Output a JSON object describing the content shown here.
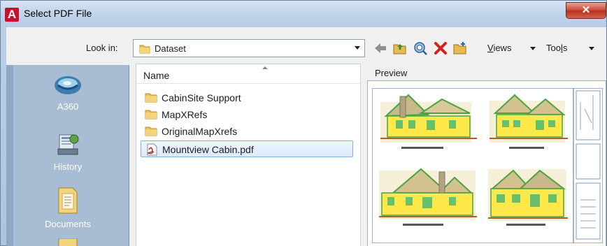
{
  "window": {
    "title": "Select PDF File",
    "app_icon": "A",
    "close_glyph": "✕"
  },
  "toolbar": {
    "look_in_label": "Look in:",
    "look_in_value": "Dataset",
    "views_label_first": "V",
    "views_label_rest": "iews",
    "tools_label_first": "Too",
    "tools_label_u": "l",
    "tools_label_rest": "s",
    "icons": [
      "back-arrow-icon",
      "up-folder-icon",
      "search-web-icon",
      "delete-icon",
      "new-folder-icon"
    ]
  },
  "places": [
    {
      "label": "A360",
      "icon": "a360-icon"
    },
    {
      "label": "History",
      "icon": "history-icon"
    },
    {
      "label": "Documents",
      "icon": "documents-icon"
    }
  ],
  "file_list": {
    "column_header": "Name",
    "items": [
      {
        "name": "CabinSite Support",
        "type": "folder"
      },
      {
        "name": "MapXRefs",
        "type": "folder"
      },
      {
        "name": "OriginalMapXrefs",
        "type": "folder"
      },
      {
        "name": "Mountview Cabin.pdf",
        "type": "pdf",
        "selected": true
      }
    ]
  },
  "preview": {
    "label": "Preview"
  },
  "colors": {
    "accent_red": "#c8102e",
    "selection_border": "#84acdd",
    "places_bg": "#a8bcd4"
  }
}
